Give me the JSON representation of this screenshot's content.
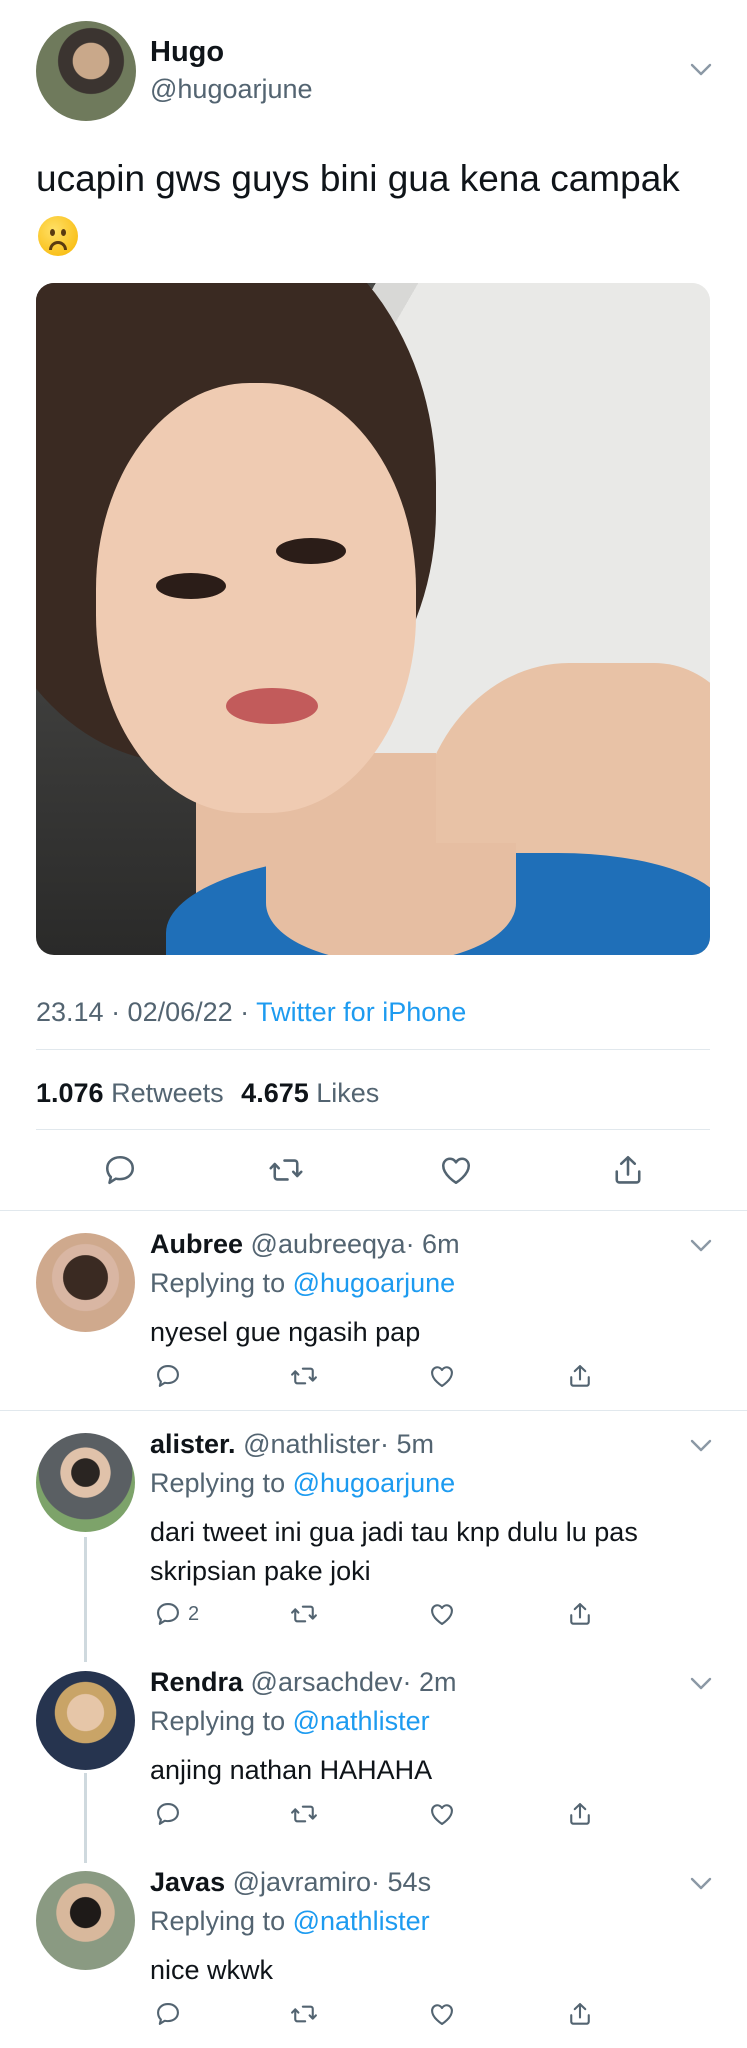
{
  "main": {
    "name": "Hugo",
    "handle": "@hugoarjune",
    "text": "ucapin gws guys bini gua kena campak",
    "emoji": "frowning-face-emoji",
    "time": "23.14 · 02/06/22 · ",
    "source": "Twitter for iPhone",
    "retweets_count": "1.076",
    "retweets_label": "Retweets",
    "likes_count": "4.675",
    "likes_label": "Likes"
  },
  "replies": [
    {
      "name": "Aubree",
      "handle": "@aubreeqya",
      "time": "· 6m",
      "replying_to_label": "Replying to",
      "replying_to": "@hugoarjune",
      "lines": [
        "nyesel gue ngasih pap"
      ],
      "reply_count": ""
    },
    {
      "name": "alister.",
      "handle": "@nathlister",
      "time": "· 5m",
      "replying_to_label": "Replying to",
      "replying_to": "@hugoarjune",
      "lines": [
        "dari tweet ini gua jadi tau knp dulu lu pas",
        "skripsian pake joki"
      ],
      "reply_count": "2"
    },
    {
      "name": "Rendra",
      "handle": "@arsachdev",
      "time": "· 2m",
      "replying_to_label": "Replying to",
      "replying_to": "@nathlister",
      "lines": [
        "anjing nathan HAHAHA"
      ],
      "reply_count": ""
    },
    {
      "name": "Javas",
      "handle": "@javramiro",
      "time": "· 54s",
      "replying_to_label": "Replying to",
      "replying_to": "@nathlister",
      "lines": [
        "nice wkwk"
      ],
      "reply_count": ""
    }
  ],
  "colors": {
    "link": "#1d9bf0",
    "muted": "#536471",
    "divider": "#e1e8ed"
  }
}
